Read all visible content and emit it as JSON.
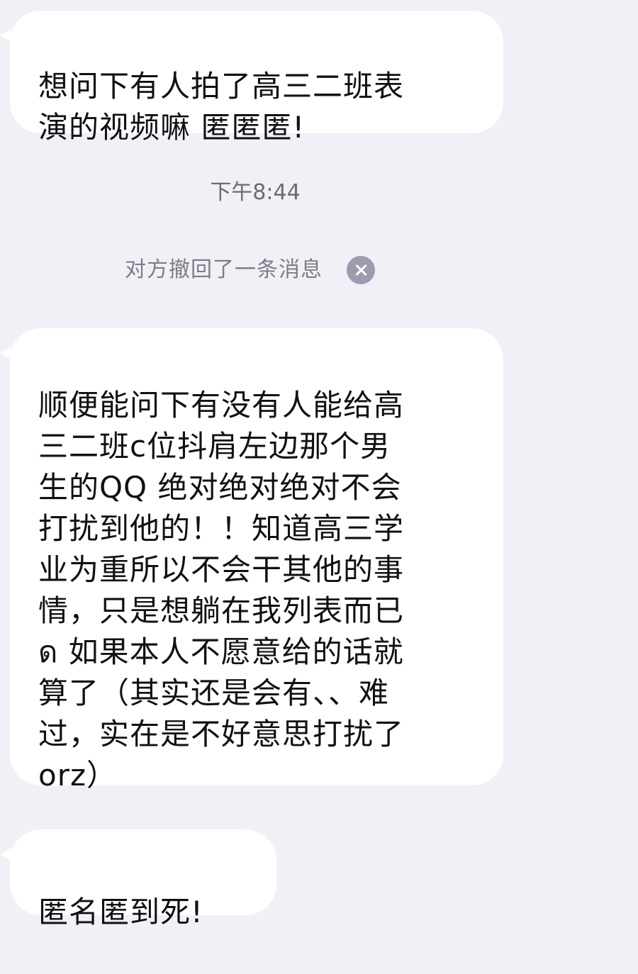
{
  "messages": [
    {
      "text": "想问下有人拍了高三二班表\n演的视频嘛 匿匿匿!"
    },
    {
      "text": "顺便能问下有没有人能给高\n三二班c位抖肩左边那个男\n生的QQ 绝对绝对绝对不会\n打扰到他的！！知道高三学\n业为重所以不会干其他的事\n情，只是想躺在我列表而已\nด 如果本人不愿意给的话就\n算了（其实还是会有、、难\n过，实在是不好意思打扰了\norz）"
    },
    {
      "text": "匿名匿到死!"
    }
  ],
  "timestamp": "下午8:44",
  "recall_notice": {
    "text": "对方撤回了一条消息",
    "icon": "close-circle-icon"
  },
  "colors": {
    "background": "#f0f0f6",
    "bubble": "#ffffff",
    "recall_icon": "#9c9cae"
  }
}
